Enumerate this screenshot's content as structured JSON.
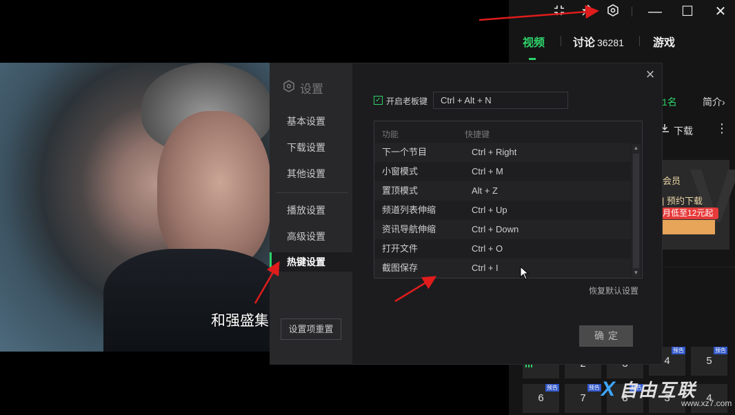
{
  "video": {
    "subtitle": "和强盛集"
  },
  "topbar": {
    "icons": [
      "fullscreen-exit-icon",
      "pin-icon",
      "settings-icon",
      "minimize-icon",
      "maximize-icon",
      "close-icon"
    ],
    "glyphs": {
      "minimize": "—",
      "maximize": "☐",
      "close": "✕"
    }
  },
  "sidebar": {
    "tabs": [
      {
        "label": "视频",
        "active": true
      },
      {
        "label": "讨论",
        "count": "36281"
      },
      {
        "label": "游戏"
      }
    ],
    "rank_text": "1名",
    "intro_text": "简介",
    "intro_chevron": "›",
    "download_text": "下载",
    "more_glyph": "⋮",
    "member_text": "会员",
    "reserve_text": "| 预约下载",
    "promo_text": "月低至12元起",
    "episodes_row1": [
      {
        "num": "2",
        "badge": ""
      },
      {
        "num": "3",
        "badge": ""
      },
      {
        "num": "4",
        "badge": "预告"
      },
      {
        "num": "5",
        "badge": "预告"
      }
    ],
    "episodes_row2": [
      {
        "num": "6",
        "badge": "预告"
      },
      {
        "num": "7",
        "badge": "预告"
      },
      {
        "num": "8",
        "badge": "预告"
      },
      {
        "num": "3",
        "badge": ""
      },
      {
        "num": "4",
        "badge": ""
      }
    ]
  },
  "watermark": {
    "x": "X",
    "name": "自由互联",
    "url": "www.xz7.com"
  },
  "dialog": {
    "title": "设置",
    "close_glyph": "×",
    "nav": [
      {
        "label": "基本设置",
        "active": false
      },
      {
        "label": "下载设置",
        "active": false
      },
      {
        "label": "其他设置",
        "active": false
      },
      {
        "label": "播放设置",
        "active": false
      },
      {
        "label": "高级设置",
        "active": false
      },
      {
        "label": "热键设置",
        "active": true
      }
    ],
    "reset_button": "设置项重置",
    "boss_key": {
      "checked": true,
      "check_glyph": "✓",
      "label": "开启老板键",
      "value": "Ctrl + Alt + N"
    },
    "hotkey_table": {
      "headers": {
        "function": "功能",
        "shortcut": "快捷键"
      },
      "rows": [
        {
          "function": "下一个节目",
          "shortcut": "Ctrl + Right"
        },
        {
          "function": "小窗模式",
          "shortcut": "Ctrl + M"
        },
        {
          "function": "置顶模式",
          "shortcut": "Alt + Z"
        },
        {
          "function": "频道列表伸缩",
          "shortcut": "Ctrl + Up"
        },
        {
          "function": "资讯导航伸缩",
          "shortcut": "Ctrl + Down"
        },
        {
          "function": "打开文件",
          "shortcut": "Ctrl + O"
        },
        {
          "function": "截图保存",
          "shortcut": "Ctrl + I"
        }
      ],
      "scroll_up": "▲",
      "scroll_down": "▼"
    },
    "restore_default": "恢复默认设置",
    "confirm_button": "确定"
  },
  "colors": {
    "accent_green": "#2ed36a",
    "annotation_red": "#e01c1c",
    "dialog_bg": "#1c1c1f",
    "nav_bg": "#28282b",
    "badge_blue": "#3157c9"
  }
}
